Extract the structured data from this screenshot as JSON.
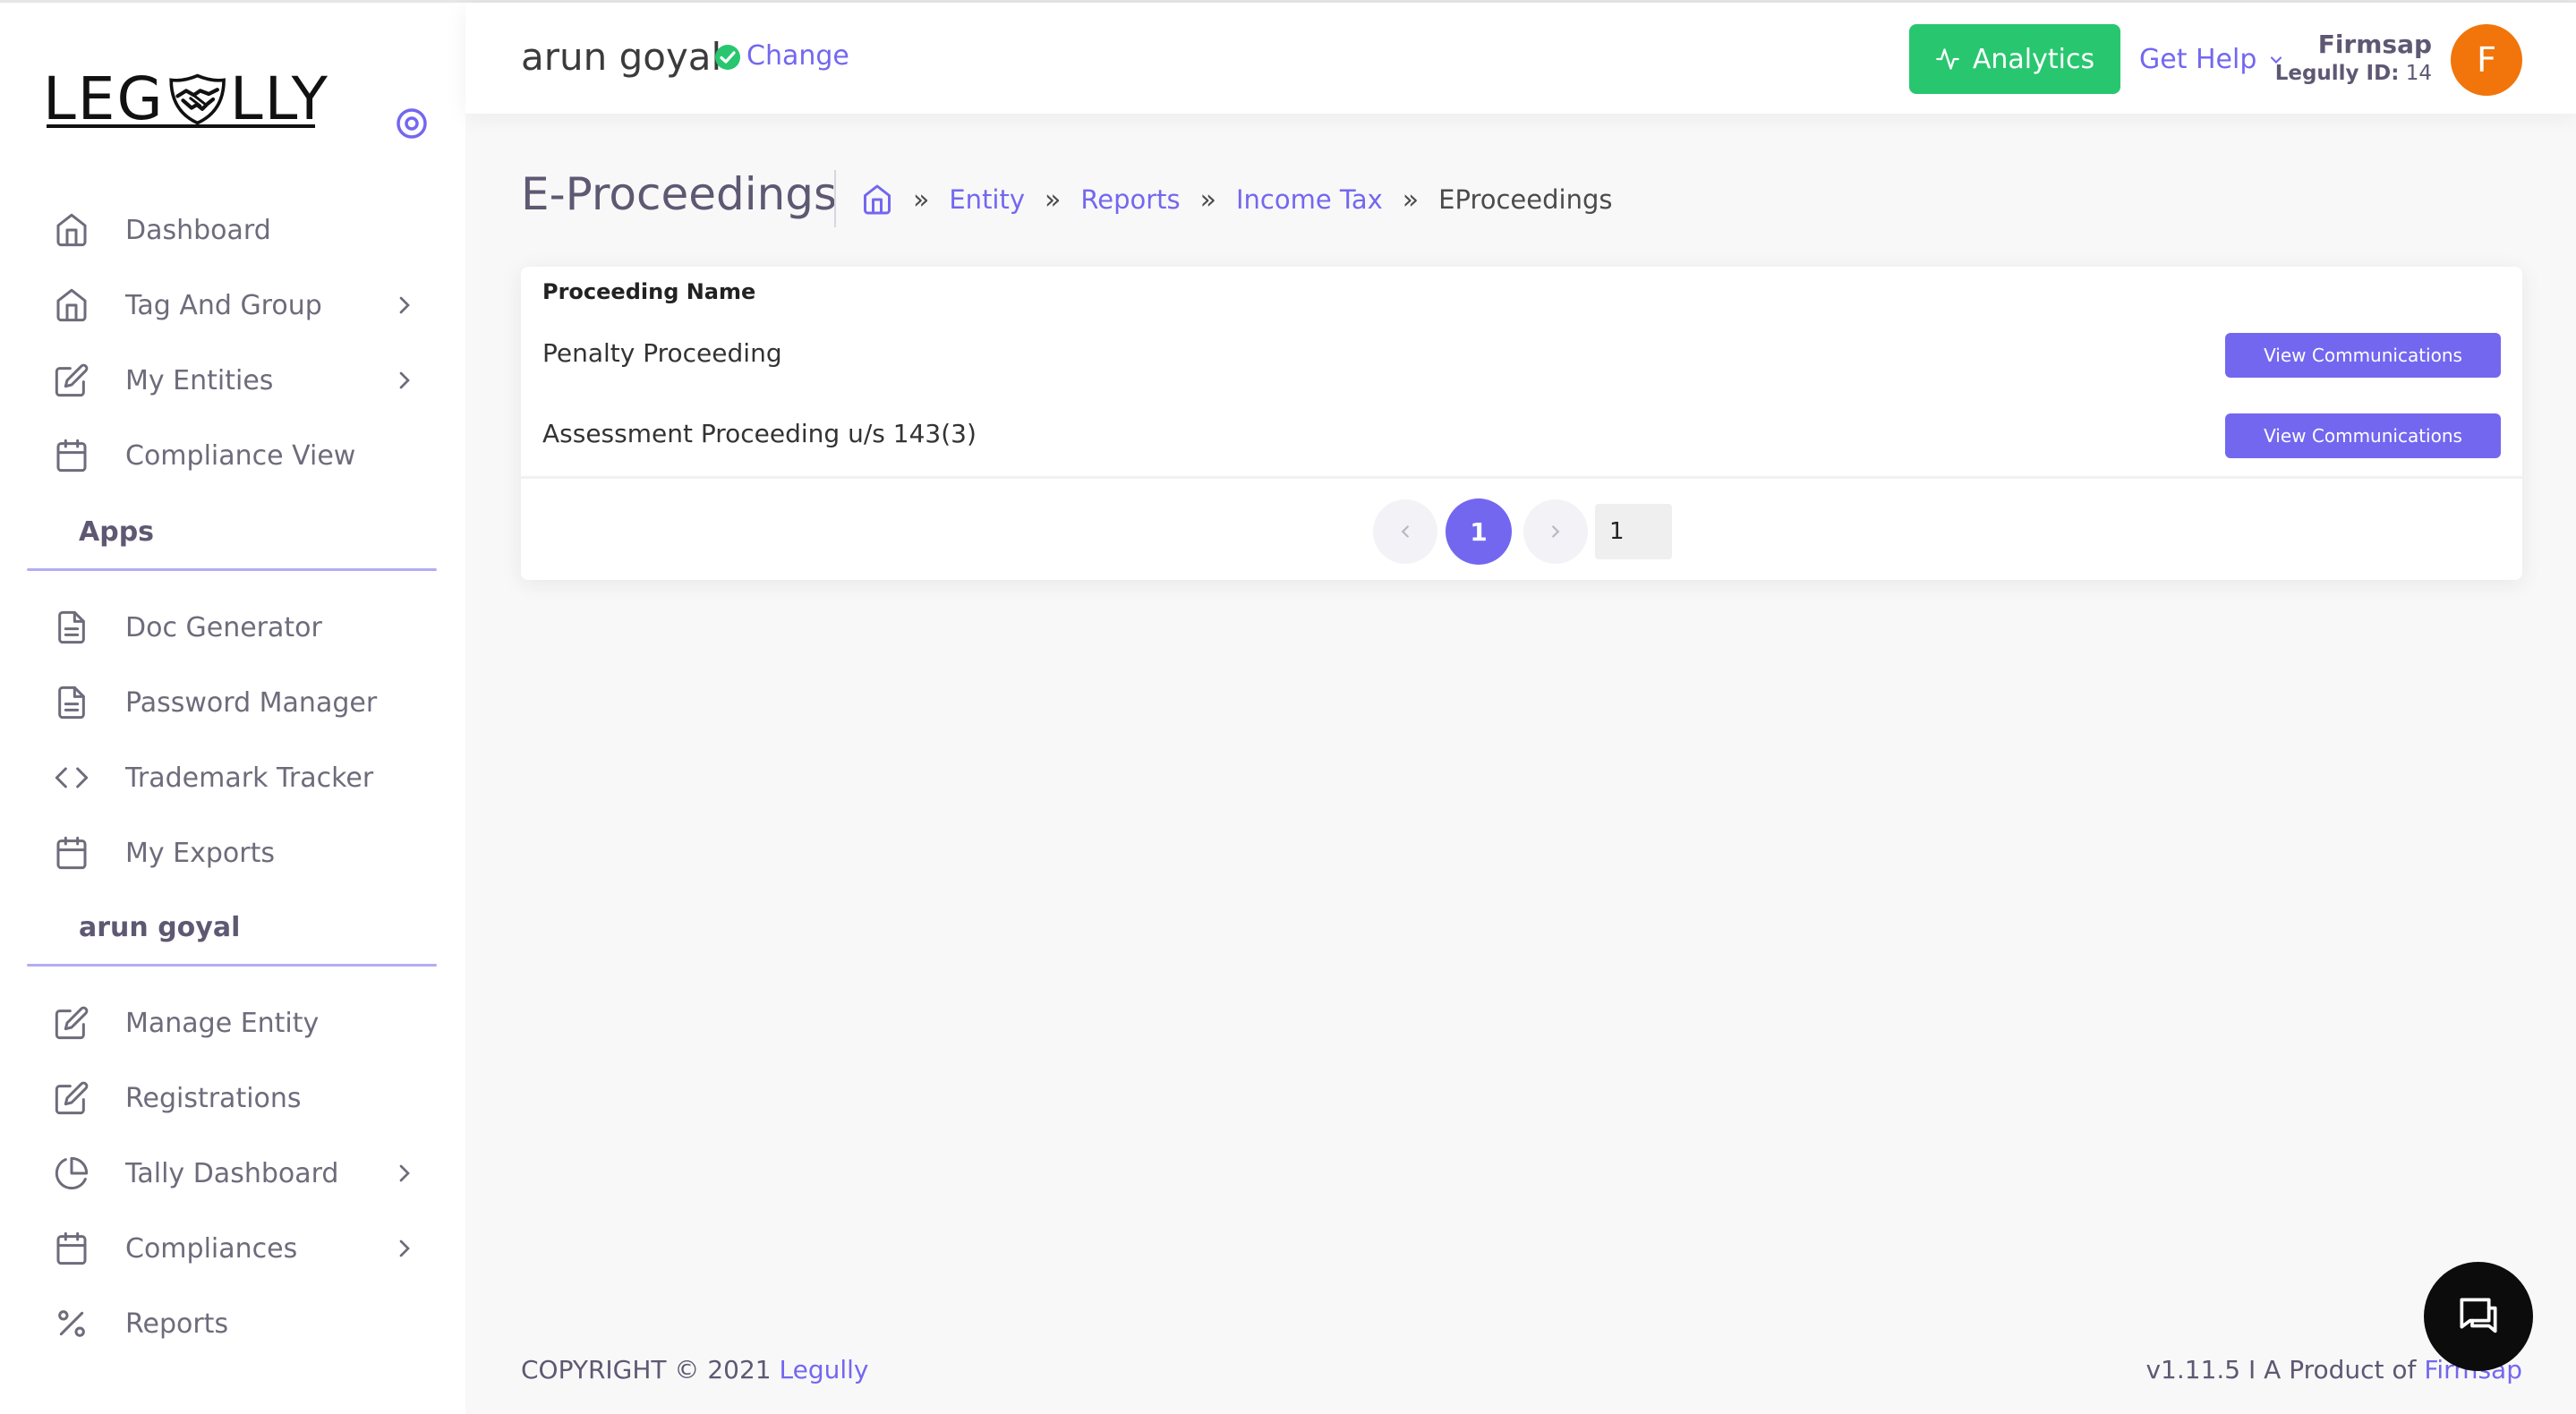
{
  "brand": {
    "logo_left": "LEG",
    "logo_right": "LLY"
  },
  "sidebar": {
    "main_items": [
      {
        "label": "Dashboard",
        "icon": "home-icon"
      },
      {
        "label": "Tag And Group",
        "icon": "home-icon",
        "has_chevron": true
      },
      {
        "label": "My Entities",
        "icon": "edit-icon",
        "has_chevron": true
      },
      {
        "label": "Compliance View",
        "icon": "calendar-icon"
      }
    ],
    "apps_heading": "Apps",
    "apps_items": [
      {
        "label": "Doc Generator",
        "icon": "file-text-icon"
      },
      {
        "label": "Password Manager",
        "icon": "file-text-icon"
      },
      {
        "label": "Trademark Tracker",
        "icon": "code-icon"
      },
      {
        "label": "My Exports",
        "icon": "calendar-icon"
      }
    ],
    "user_heading": "arun goyal",
    "user_items": [
      {
        "label": "Manage Entity",
        "icon": "edit-icon"
      },
      {
        "label": "Registrations",
        "icon": "edit-icon"
      },
      {
        "label": "Tally Dashboard",
        "icon": "pie-chart-icon",
        "has_chevron": true
      },
      {
        "label": "Compliances",
        "icon": "calendar-icon",
        "has_chevron": true
      },
      {
        "label": "Reports",
        "icon": "percent-icon"
      }
    ]
  },
  "header": {
    "user_name": "arun goyal",
    "change_label": "Change",
    "analytics_label": "Analytics",
    "help_label": "Get Help",
    "firm_name": "Firmsap",
    "id_label": "Legully ID:",
    "id_value": "14",
    "avatar_letter": "F"
  },
  "page": {
    "title": "E-Proceedings",
    "breadcrumb": [
      "Entity",
      "Reports",
      "Income Tax"
    ],
    "breadcrumb_current": "EProceedings"
  },
  "table": {
    "column_header": "Proceeding Name",
    "rows": [
      {
        "name": "Penalty Proceeding",
        "action": "View Communications"
      },
      {
        "name": "Assessment Proceeding u/s 143(3)",
        "action": "View Communications"
      }
    ]
  },
  "pagination": {
    "current_page": "1",
    "page_input_value": "1"
  },
  "footer": {
    "copyright_prefix": "COPYRIGHT © 2021",
    "copyright_link": "Legully",
    "version_prefix": "v1.11.5 I A Product of",
    "version_link": "Firmsap"
  },
  "colors": {
    "primary": "#7367f0",
    "success": "#28c76f",
    "avatar": "#f1750a"
  }
}
